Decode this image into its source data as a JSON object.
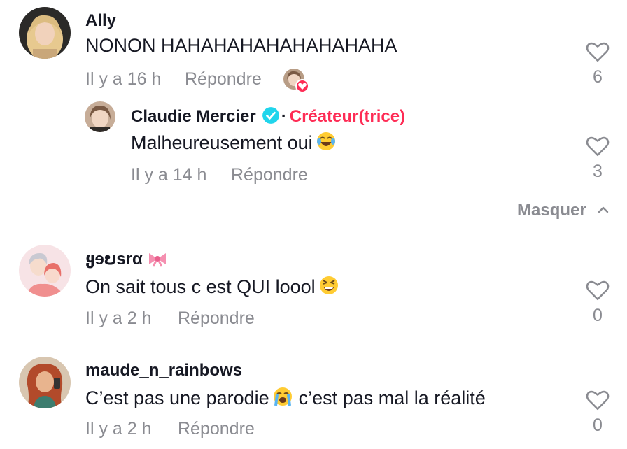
{
  "comments": [
    {
      "username": "Ally",
      "text": "NONON HAHAHAHAHAHAHAHAHA",
      "time": "Il y a 16 h",
      "reply_label": "Répondre",
      "likes": "6",
      "creator_liked": true,
      "replies": [
        {
          "username": "Claudie Mercier",
          "verified": true,
          "creator_separator": "·",
          "creator_label": "Créateur(trice)",
          "text": "Malheureusement oui",
          "emoji": "laughing-tears-emoji",
          "time": "Il y a 14 h",
          "reply_label": "Répondre",
          "likes": "3"
        }
      ],
      "hide_label": "Masquer"
    },
    {
      "username": "ყɘບsrα",
      "username_decoration": "ribbon-emoji",
      "text": "On sait tous c est QUI loool",
      "emoji": "grinning-squinting-emoji",
      "time": "Il y a 2 h",
      "reply_label": "Répondre",
      "likes": "0"
    },
    {
      "username": "maude_n_rainbows",
      "text_before": "C’est pas une parodie",
      "emoji": "loudly-crying-emoji",
      "text_after": "c’est pas mal la réalité",
      "time": "Il y a 2 h",
      "reply_label": "Répondre",
      "likes": "0"
    }
  ],
  "colors": {
    "text": "#161823",
    "meta": "#8a8b91",
    "creator": "#fe2c55",
    "verified": "#20d5ec"
  }
}
